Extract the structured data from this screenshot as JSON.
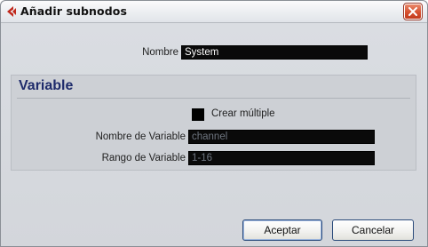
{
  "window": {
    "title": "Añadir subnodos"
  },
  "header": {
    "name_label": "Nombre",
    "name_value": "System"
  },
  "variable_section": {
    "title": "Variable",
    "create_multiple_label": "Crear múltiple",
    "create_multiple_checked": false,
    "variable_name_label": "Nombre de Variable",
    "variable_name_value": "channel",
    "variable_range_label": "Rango de Variable",
    "variable_range_value": "1-16"
  },
  "buttons": {
    "accept_label": "Aceptar",
    "cancel_label": "Cancelar"
  },
  "icons": {
    "app": "cubase-arrow-icon",
    "close": "close-icon"
  },
  "colors": {
    "section_title": "#1e2b6b",
    "close_button": "#d6502f",
    "app_icon": "#c0281c"
  }
}
